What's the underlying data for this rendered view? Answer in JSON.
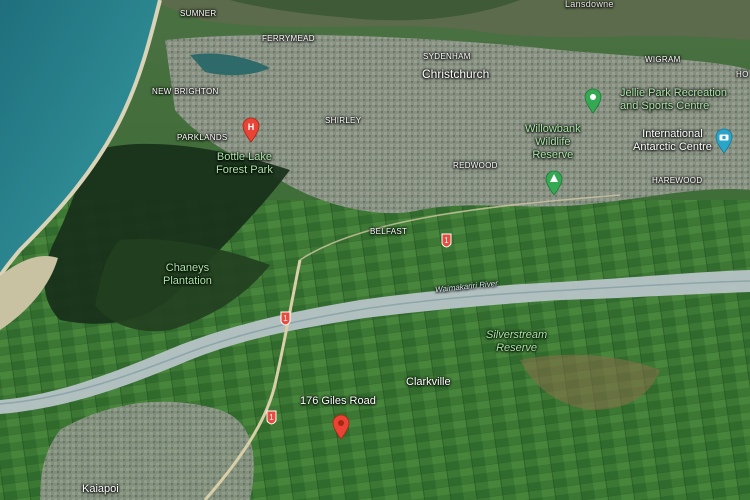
{
  "places": {
    "suburbs": {
      "sumner": "SUMNER",
      "lansdowne": "Lansdowne",
      "ferrymead": "FERRYMEAD",
      "sydenham": "SYDENHAM",
      "wigram": "WIGRAM",
      "new_brighton": "NEW BRIGHTON",
      "parklands": "PARKLANDS",
      "shirley": "SHIRLEY",
      "redwood": "REDWOOD",
      "harewood": "HAREWOOD",
      "belfast": "BELFAST",
      "hornby_edge": "HO"
    },
    "city": "Christchurch",
    "towns": {
      "clarkville": "Clarkville",
      "kaiapoi": "Kaiapoi"
    },
    "parks": {
      "jellie": "Jellie Park Recreation and Sports Centre",
      "jellie_line1": "Jellie Park Recreation",
      "jellie_line2": "and Sports Centre",
      "willowbank_line1": "Willowbank",
      "willowbank_line2": "Wildlife",
      "willowbank_line3": "Reserve",
      "antarctic_line1": "International",
      "antarctic_line2": "Antarctic Centre",
      "bottle_lake_line1": "Bottle Lake",
      "bottle_lake_line2": "Forest Park",
      "chaneys_line1": "Chaneys",
      "chaneys_line2": "Plantation",
      "silverstream_line1": "Silverstream",
      "silverstream_line2": "Reserve"
    },
    "river": "Waimakariri River",
    "address": "176 Giles Road"
  },
  "highway_shields": [
    "1",
    "1",
    "1"
  ],
  "icons": {
    "hospital": "hospital-pin-icon",
    "park": "park-pin-icon",
    "attraction": "camera-pin-icon",
    "destination": "location-pin-icon"
  },
  "colors": {
    "sea": "#2b7f8a",
    "farmland": "#3d7336",
    "urban": "#8a8f86",
    "river": "#b7c4c7",
    "label_green": "#a9e6a6",
    "pin_red": "#ea4335",
    "pin_green": "#34a853",
    "pin_teal": "#2aa5c9"
  }
}
